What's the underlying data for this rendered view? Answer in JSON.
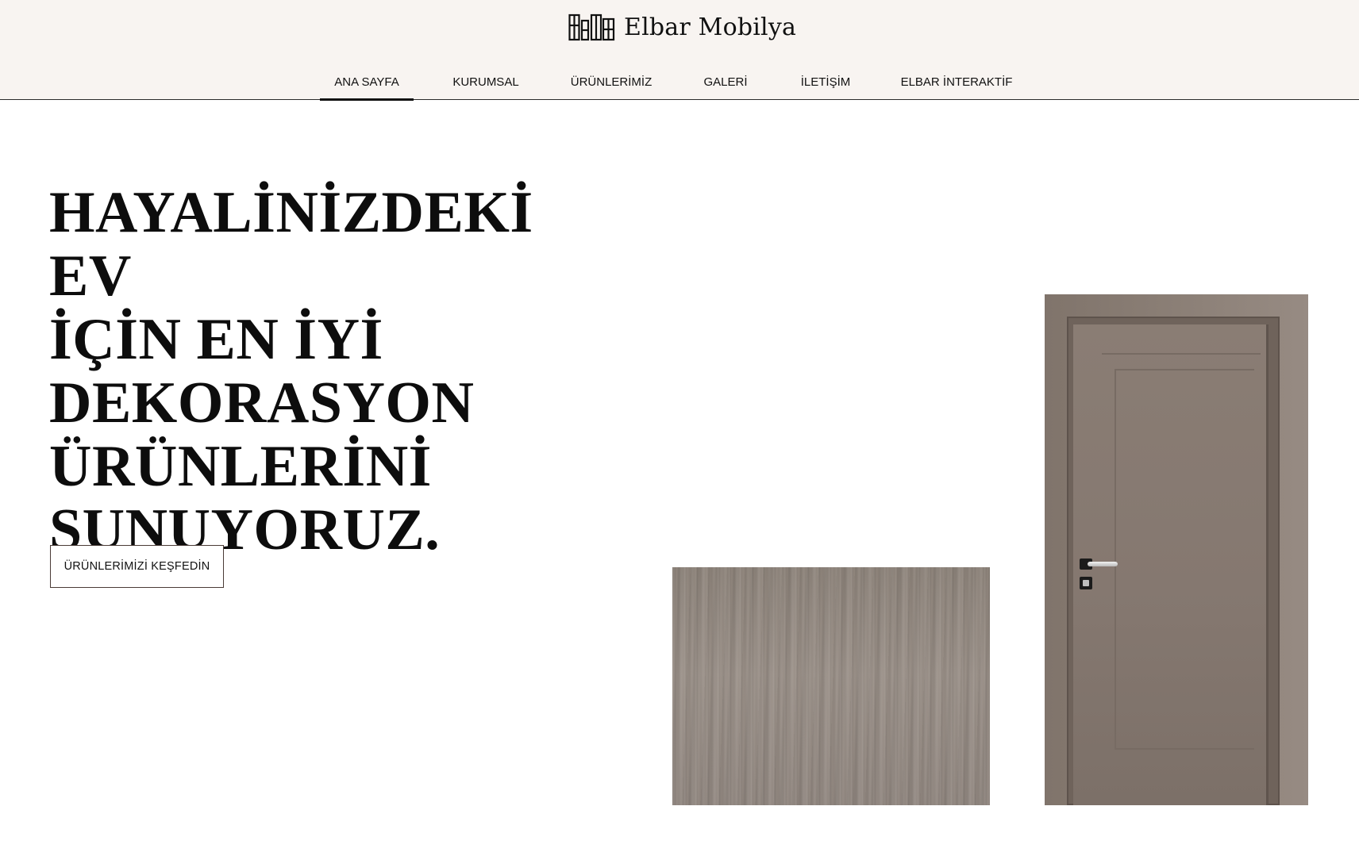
{
  "brand": {
    "name": "Elbar Mobilya",
    "logo_icon": "bookshelf-logo-icon"
  },
  "nav": {
    "items": [
      {
        "label": "ANA SAYFA",
        "active": true
      },
      {
        "label": "KURUMSAL",
        "active": false
      },
      {
        "label": "ÜRÜNLERİMİZ",
        "active": false
      },
      {
        "label": "GALERİ",
        "active": false
      },
      {
        "label": "İLETİŞİM",
        "active": false
      },
      {
        "label": "ELBAR İNTERAKTİF",
        "active": false
      }
    ]
  },
  "hero": {
    "title_lines": [
      "HAYALİNİZDEKİ EV",
      "İÇİN EN İYİ",
      "DEKORASYON",
      "ÜRÜNLERİNİ",
      "SUNUYORUZ."
    ],
    "cta_label": "ÜRÜNLERİMİZİ KEŞFEDİN"
  },
  "images": {
    "wood_sample": "wood-texture-image",
    "door": "interior-door-image"
  },
  "colors": {
    "header_bg": "#f8f4f1",
    "text": "#111111",
    "cta_border": "#4a3b36",
    "door": "#857870",
    "wood": "#958b83"
  }
}
